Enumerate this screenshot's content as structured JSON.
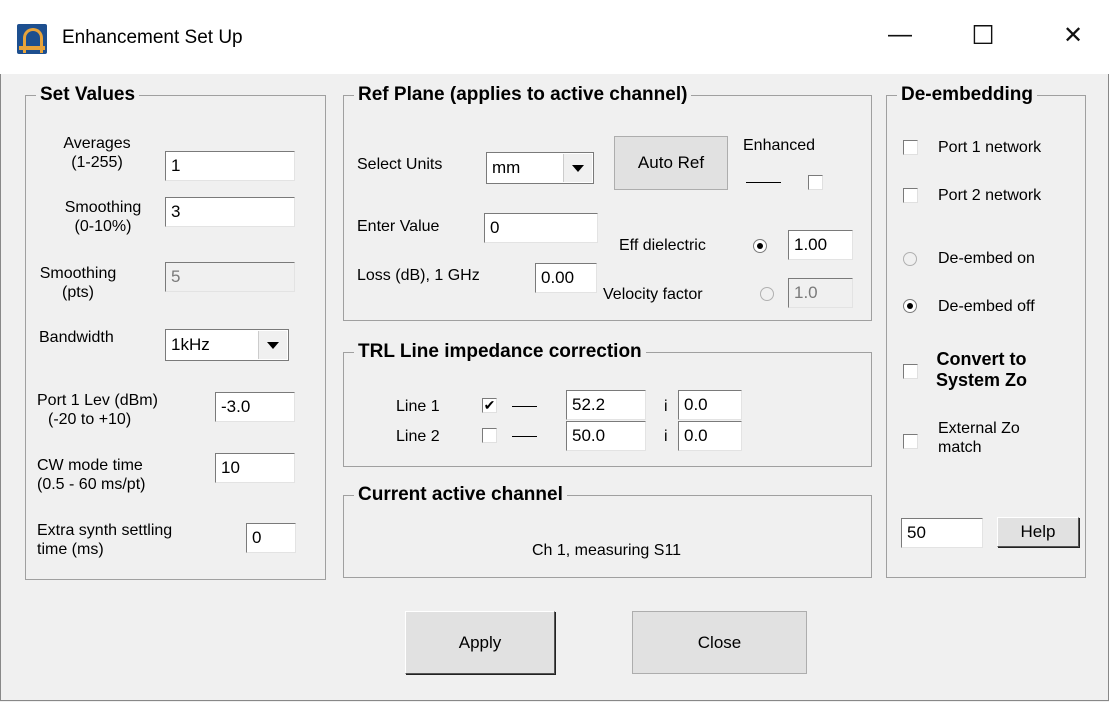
{
  "window": {
    "title": "Enhancement Set Up",
    "minimize": "—",
    "maximize": "☐",
    "close": "✕"
  },
  "set_values": {
    "legend": "Set Values",
    "averages_label_1": "Averages",
    "averages_label_2": "(1-255)",
    "averages_value": "1",
    "smoothing_pct_label_1": "Smoothing",
    "smoothing_pct_label_2": "(0-10%)",
    "smoothing_pct_value": "3",
    "smoothing_pts_label_1": "Smoothing",
    "smoothing_pts_label_2": "(pts)",
    "smoothing_pts_value": "5",
    "bandwidth_label": "Bandwidth",
    "bandwidth_value": "1kHz",
    "port1_label_1": "Port 1 Lev (dBm)",
    "port1_label_2": "(-20 to +10)",
    "port1_value": "-3.0",
    "cw_label_1": "CW mode time",
    "cw_label_2": "(0.5 - 60 ms/pt)",
    "cw_value": "10",
    "extra_label_1": "Extra synth settling",
    "extra_label_2": "time (ms)",
    "extra_value": "0"
  },
  "ref_plane": {
    "legend": "Ref Plane (applies to active channel)",
    "units_label": "Select Units",
    "units_value": "mm",
    "auto_ref": "Auto Ref",
    "enhanced_label": "Enhanced",
    "enter_value_label": "Enter Value",
    "enter_value": "0",
    "loss_label": "Loss (dB), 1 GHz",
    "loss_value": "0.00",
    "eff_dielectric_label": "Eff dielectric",
    "eff_dielectric_value": "1.00",
    "velocity_label": "Velocity factor",
    "velocity_value": "1.0"
  },
  "trl": {
    "legend": "TRL Line impedance correction",
    "line1_label": "Line 1",
    "line1_real": "52.2",
    "line1_imag": "0.0",
    "line2_label": "Line 2",
    "line2_real": "50.0",
    "line2_imag": "0.0",
    "imag_symbol": "i"
  },
  "active_channel": {
    "legend": "Current active channel",
    "text": "Ch 1, measuring S11"
  },
  "deembed": {
    "legend": "De-embedding",
    "port1": "Port 1 network",
    "port2": "Port 2 network",
    "on": "De-embed on",
    "off": "De-embed off",
    "convert_1": "Convert to",
    "convert_2": "System Zo",
    "external_1": "External Zo",
    "external_2": "match",
    "zo_value": "50",
    "help": "Help"
  },
  "footer": {
    "apply": "Apply",
    "close": "Close"
  }
}
